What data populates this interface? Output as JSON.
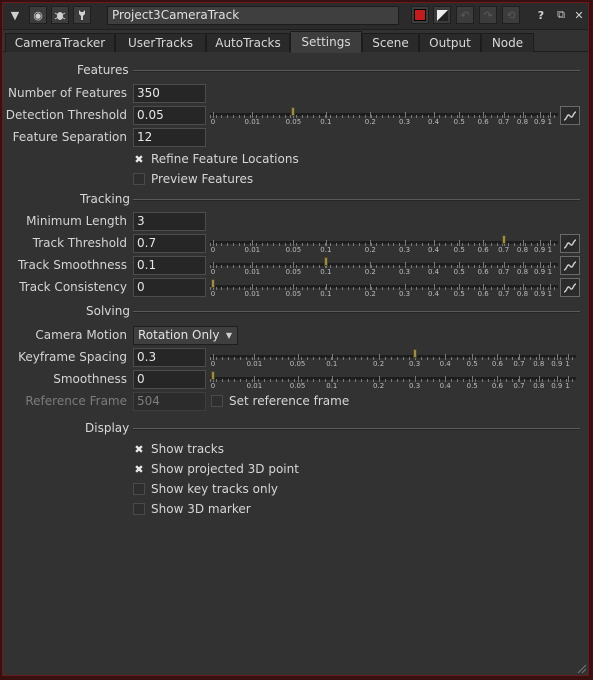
{
  "node_name": "Project3CameraTrack",
  "tabs": [
    {
      "label": "CameraTracker"
    },
    {
      "label": "UserTracks"
    },
    {
      "label": "AutoTracks"
    },
    {
      "label": "Settings",
      "active": true
    },
    {
      "label": "Scene"
    },
    {
      "label": "Output"
    },
    {
      "label": "Node"
    }
  ],
  "features": {
    "section": "Features",
    "number_label": "Number of Features",
    "number_value": "350",
    "threshold_label": "Detection Threshold",
    "threshold_value": "0.05",
    "separation_label": "Feature Separation",
    "separation_value": "12",
    "refine_label": "Refine Feature Locations",
    "refine_checked": true,
    "preview_label": "Preview Features",
    "preview_checked": false
  },
  "tracking": {
    "section": "Tracking",
    "min_length_label": "Minimum Length",
    "min_length_value": "3",
    "threshold_label": "Track Threshold",
    "threshold_value": "0.7",
    "smoothness_label": "Track Smoothness",
    "smoothness_value": "0.1",
    "consistency_label": "Track Consistency",
    "consistency_value": "0"
  },
  "solving": {
    "section": "Solving",
    "motion_label": "Camera Motion",
    "motion_value": "Rotation Only",
    "keyframe_label": "Keyframe Spacing",
    "keyframe_value": "0.3",
    "smoothness_label": "Smoothness",
    "smoothness_value": "0",
    "ref_frame_label": "Reference Frame",
    "ref_frame_value": "504",
    "set_ref_label": "Set reference frame",
    "set_ref_checked": false
  },
  "display": {
    "section": "Display",
    "items": [
      {
        "label": "Show tracks",
        "checked": true
      },
      {
        "label": "Show projected 3D point",
        "checked": true
      },
      {
        "label": "Show key tracks only",
        "checked": false
      },
      {
        "label": "Show 3D marker",
        "checked": false
      }
    ]
  },
  "slider_tick_labels": [
    "0",
    "0.01",
    "0.05",
    "0.1",
    "0.2",
    "0.3",
    "0.4",
    "0.5",
    "0.6",
    "0.7",
    "0.8",
    "0.9",
    "1"
  ],
  "sliders": {
    "detection_threshold": 0.05,
    "track_threshold": 0.7,
    "track_smoothness": 0.1,
    "track_consistency": 0,
    "keyframe_spacing": 0.3,
    "smoothness": 0
  },
  "colors": {
    "panel_bg": "#323232",
    "border": "#6a1c1c",
    "handle": "#9c8d4a"
  }
}
